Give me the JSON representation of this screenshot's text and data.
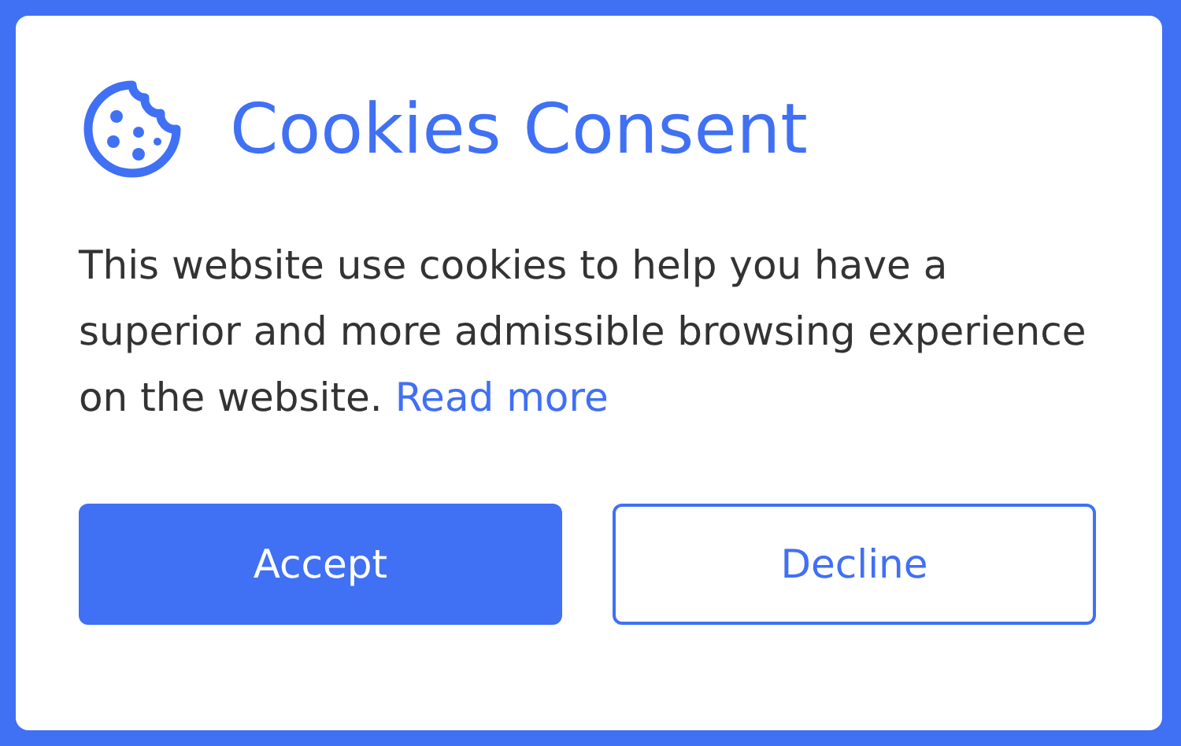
{
  "title": "Cookies Consent",
  "message": "This website use cookies to help you have a superior and more admissible browsing experience on the website.",
  "link": "Read more",
  "buttons": [
    {
      "label": "Accept",
      "kind": "primary"
    },
    {
      "label": "Decline",
      "kind": "outline"
    }
  ]
}
